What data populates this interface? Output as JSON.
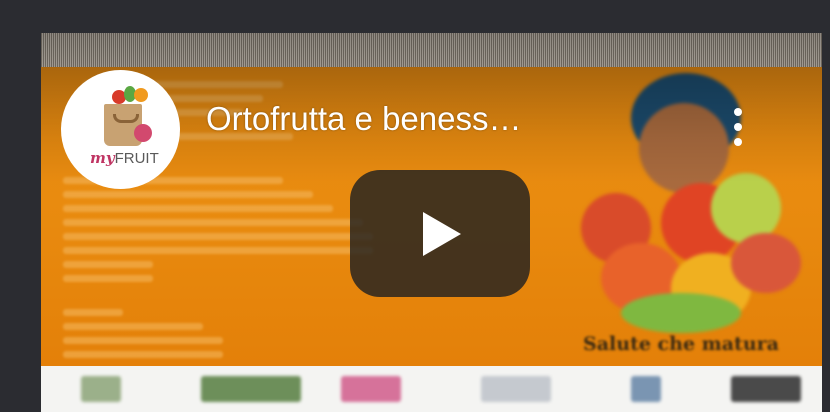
{
  "video": {
    "title": "Ortofrutta e beness…",
    "channel_logo_text_prefix": "my",
    "channel_logo_text_suffix": "FRUIT",
    "slogan": "Salute che matura"
  },
  "icons": {
    "menu": "kebab-menu-icon",
    "play": "play-icon"
  },
  "colors": {
    "background": "#2b2c31",
    "thumbnail_orange": "#e98b0f",
    "play_button": "#212121"
  }
}
